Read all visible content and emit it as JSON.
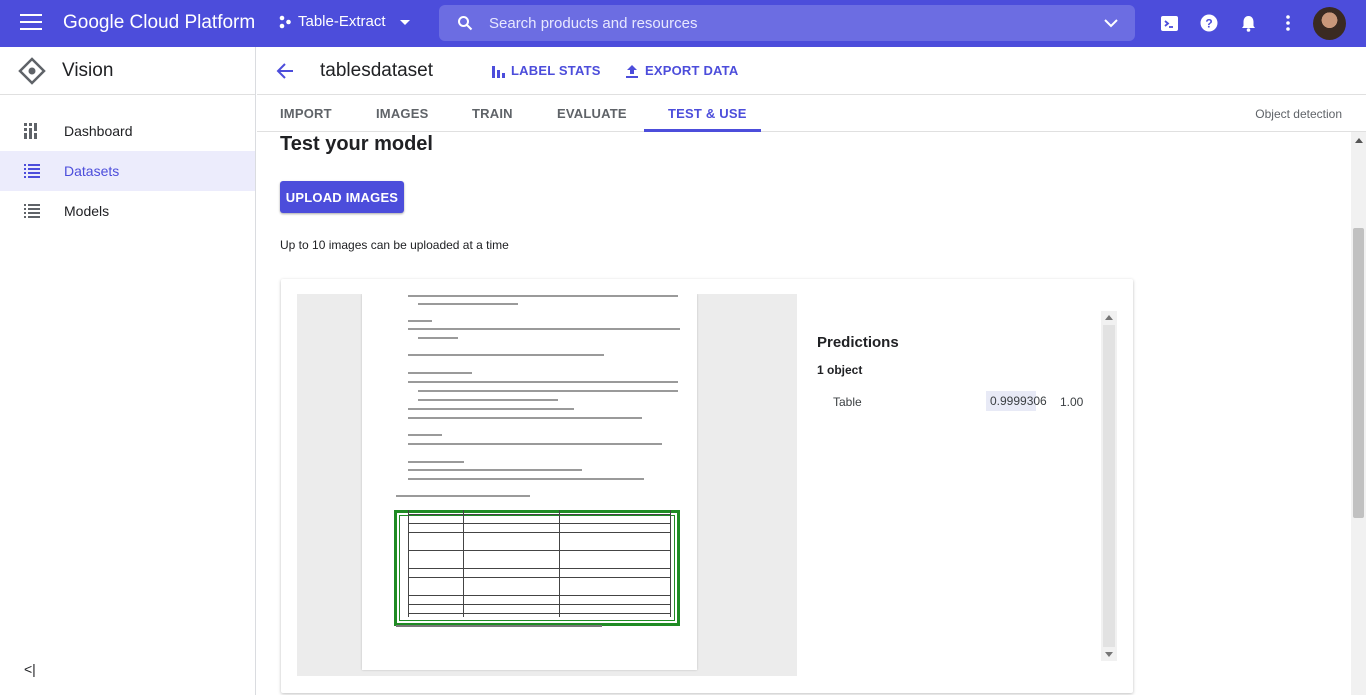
{
  "topbar": {
    "brand": "Google Cloud Platform",
    "project": "Table-Extract",
    "search_placeholder": "Search products and resources",
    "bg_color": "#4c4ddb"
  },
  "sidebar": {
    "title": "Vision",
    "items": [
      {
        "label": "Dashboard",
        "icon": "dashboard-icon",
        "active": false
      },
      {
        "label": "Datasets",
        "icon": "list-icon",
        "active": true
      },
      {
        "label": "Models",
        "icon": "list-icon",
        "active": false
      }
    ],
    "collapse_label": "<|"
  },
  "header": {
    "dataset_name": "tablesdataset",
    "label_stats": "LABEL STATS",
    "export_data": "EXPORT DATA"
  },
  "tabs": {
    "items": [
      "IMPORT",
      "IMAGES",
      "TRAIN",
      "EVALUATE",
      "TEST & USE"
    ],
    "active": "TEST & USE",
    "mode_label": "Object detection"
  },
  "main": {
    "heading": "Test your model",
    "upload_button": "UPLOAD IMAGES",
    "upload_note": "Up to 10 images can be uploaded at a time"
  },
  "predictions": {
    "title": "Predictions",
    "count": "1 object",
    "rows": [
      {
        "label": "Table",
        "score": "0.9999306",
        "score_fraction": 0.75,
        "max": "1.00"
      }
    ]
  }
}
